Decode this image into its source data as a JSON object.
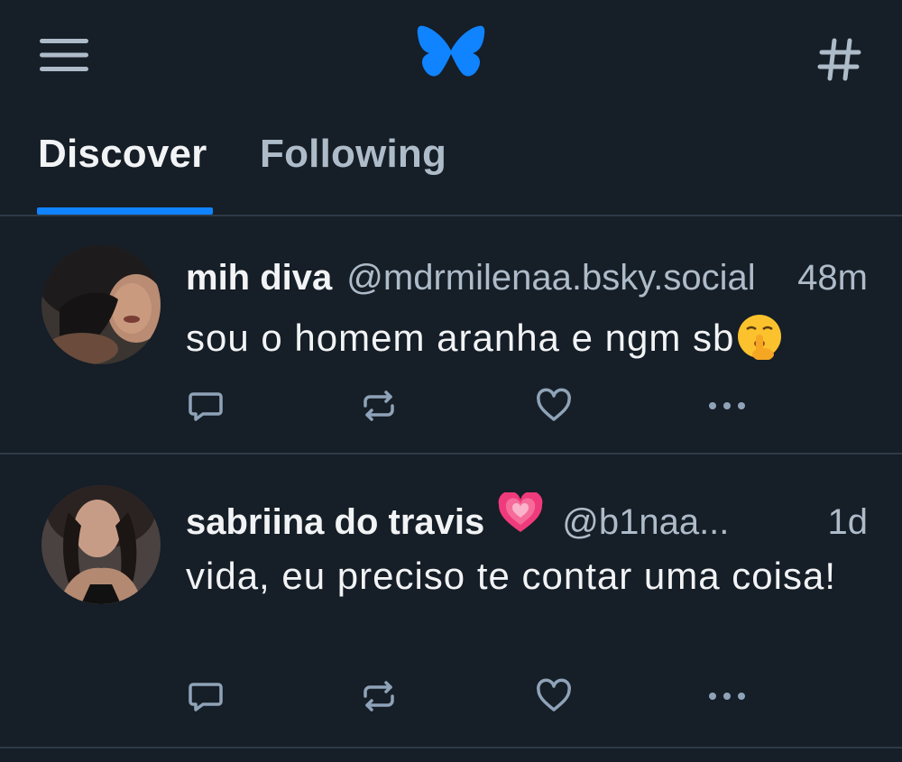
{
  "header": {
    "menu_icon": "hamburger-menu-icon",
    "logo_icon": "bluesky-butterfly-logo",
    "feeds_icon": "hash-icon",
    "brand_color": "#1083fe"
  },
  "tabs": [
    {
      "label": "Discover",
      "selected": true
    },
    {
      "label": "Following",
      "selected": false
    }
  ],
  "posts": [
    {
      "display_name": "mih diva",
      "name_emoji": "",
      "handle": "@mdrmilenaa.bsky.social",
      "time": "48m",
      "text": "sou o homem aranha e ngm sb",
      "text_emoji": "shushing-face-emoji",
      "actions": [
        "reply-icon",
        "repost-icon",
        "like-icon",
        "more-icon"
      ]
    },
    {
      "display_name": "sabriina do travis",
      "name_emoji": "sparkling-heart-emoji",
      "handle": "@b1naa...",
      "time": "1d",
      "text": "vida, eu preciso te contar uma coisa!",
      "text_emoji": "",
      "actions": [
        "reply-icon",
        "repost-icon",
        "like-icon",
        "more-icon"
      ]
    }
  ],
  "colors": {
    "background": "#161e27",
    "primary_text": "#f1f3f5",
    "secondary_text": "#aebbc9",
    "divider": "#2e3a47",
    "accent": "#1083fe",
    "icon": "#8fa3b8"
  }
}
